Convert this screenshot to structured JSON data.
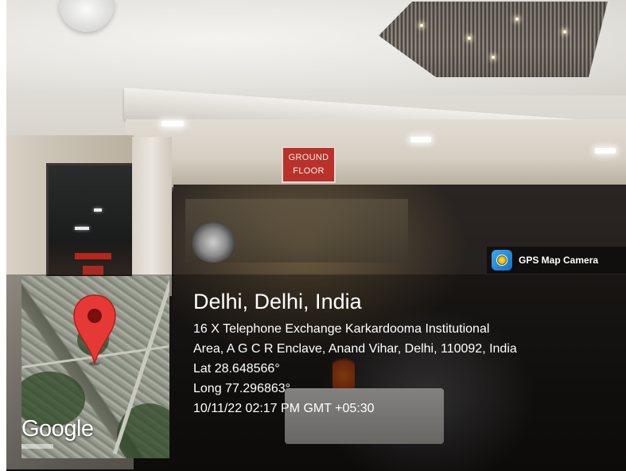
{
  "scene": {
    "floor_sign": {
      "line1": "GROUND",
      "line2": "FLOOR"
    }
  },
  "badge": {
    "icon": "gps-map-camera-icon",
    "app_name": "GPS Map Camera"
  },
  "map": {
    "pin_icon": "map-pin-icon",
    "provider_logo": "Google"
  },
  "location": {
    "title": "Delhi, Delhi, India",
    "address_line1": "16 X Telephone Exchange Karkardooma Institutional",
    "address_line2": "Area, A G C R Enclave, Anand Vihar, Delhi, 110092, India",
    "latitude": "Lat 28.648566°",
    "longitude": "Long 77.296863°",
    "timestamp": "10/11/22 02:17 PM GMT +05:30"
  },
  "colors": {
    "overlay": "#000000",
    "pin": "#e53935",
    "sign": "#b8312a",
    "text": "#ffffff"
  }
}
